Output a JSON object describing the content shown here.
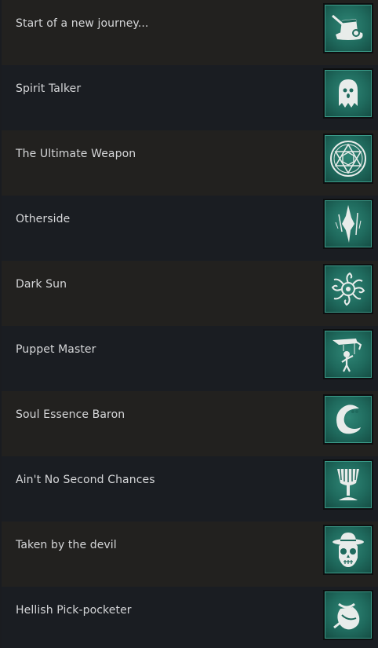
{
  "achievements": [
    {
      "title": "Start of a new journey...",
      "icon": "top-hat-skull-icon"
    },
    {
      "title": "Spirit Talker",
      "icon": "ghost-icon"
    },
    {
      "title": "The Ultimate Weapon",
      "icon": "hexagram-circle-icon"
    },
    {
      "title": "Otherside",
      "icon": "rift-icon"
    },
    {
      "title": "Dark Sun",
      "icon": "tentacle-sun-icon"
    },
    {
      "title": "Puppet Master",
      "icon": "marionette-icon"
    },
    {
      "title": "Soul Essence Baron",
      "icon": "soul-wisp-icon"
    },
    {
      "title": "Ain't No Second Chances",
      "icon": "goblet-icon"
    },
    {
      "title": "Taken by the devil",
      "icon": "hat-skull-icon"
    },
    {
      "title": "Hellish Pick-pocketer",
      "icon": "coin-pouch-icon"
    }
  ],
  "colors": {
    "row_dark": "#1a1d22",
    "row_warm": "#22211f",
    "icon_teal": "#1f6a5d",
    "text": "#d6d7d9"
  }
}
